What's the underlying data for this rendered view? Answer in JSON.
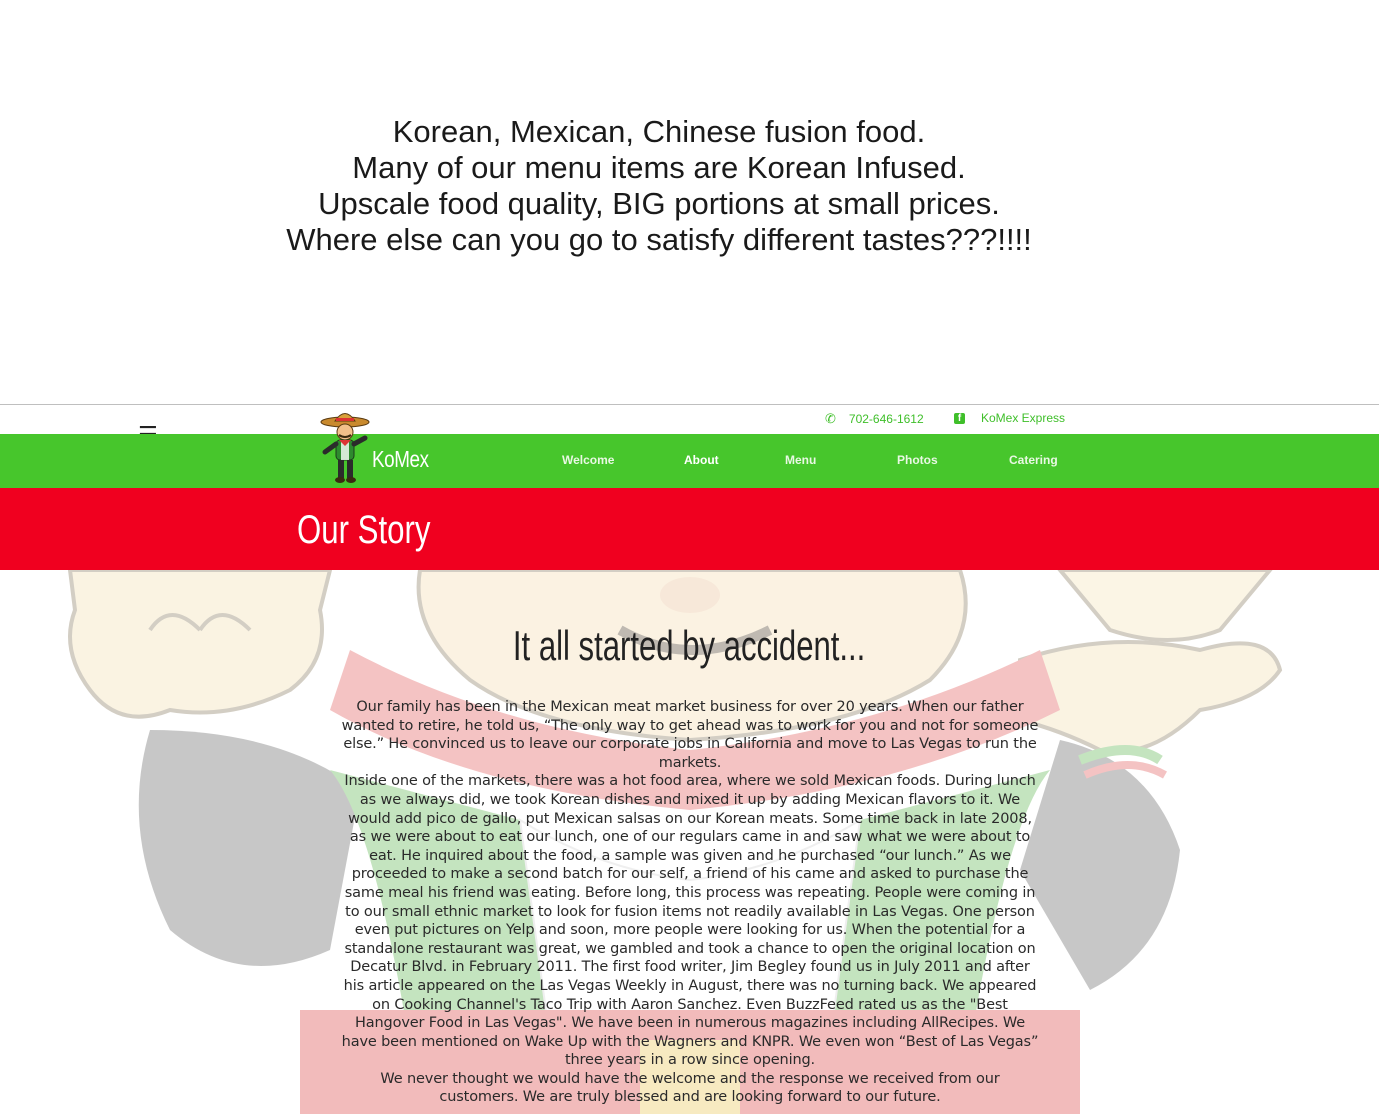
{
  "banner": {
    "lines": [
      "Korean, Mexican, Chinese fusion food.",
      "Many of our menu items are Korean Infused.",
      "Upscale food quality, BIG portions at small prices.",
      "Where else can you go to satisfy different tastes???!!!!"
    ]
  },
  "topbar": {
    "phone": "702-646-1612",
    "facebook": "KoMex Express",
    "icons": {
      "phone": "phone-icon",
      "facebook": "facebook-icon",
      "menu": "hamburger-menu-icon"
    }
  },
  "nav": {
    "brand": "KoMex",
    "items": [
      {
        "label": "Welcome",
        "active": false
      },
      {
        "label": "About",
        "active": true
      },
      {
        "label": "Menu",
        "active": false
      },
      {
        "label": "Photos",
        "active": false
      },
      {
        "label": "Catering",
        "active": false
      }
    ]
  },
  "page": {
    "title": "Our Story",
    "headline": "It all started by accident...",
    "paragraphs": [
      "Our family has been in the Mexican meat market business for over 20 years. When our father wanted to retire, he told us, “The only way to get ahead was to work for you and not for someone else.” He convinced us to leave our corporate jobs in California and move to Las Vegas to run the markets.",
      "Inside one of the markets, there was a hot food area, where we sold Mexican foods. During lunch as we always did, we took Korean dishes and mixed it up by adding Mexican flavors to it. We would add pico de gallo, put Mexican salsas on our Korean meats. Some time back in late 2008, as we were about to eat our lunch, one of our regulars came in and saw what we were about to eat. He inquired about the food, a sample was given and he purchased “our lunch.” As we proceeded to make a second batch for our self, a friend of his came and asked to purchase the same meal his friend was eating. Before long, this process was repeating. People were coming in to our small ethnic market to look for fusion items not readily available in Las Vegas. One person even put pictures on Yelp and soon, more people were looking for us. When the potential for a standalone restaurant was great, we gambled and took a chance to open the original location on Decatur Blvd. in February 2011. The first food writer, Jim Begley found us in July 2011 and after his article appeared on the Las Vegas Weekly in August, there was no turning back. We appeared on Cooking Channel's Taco Trip with Aaron Sanchez. Even BuzzFeed rated us as the \"Best Hangover Food in Las Vegas\". We have been in numerous magazines including AllRecipes. We have been mentioned on Wake Up with the Wagners and KNPR. We even won “Best of Las Vegas” three years in a row since opening.",
      "We never thought we would have the welcome and the response we received from our customers. We are truly blessed and are looking forward to our future."
    ]
  },
  "colors": {
    "nav_green": "#47c62c",
    "header_red": "#f0001f",
    "contact_green": "#3fbf2a"
  }
}
